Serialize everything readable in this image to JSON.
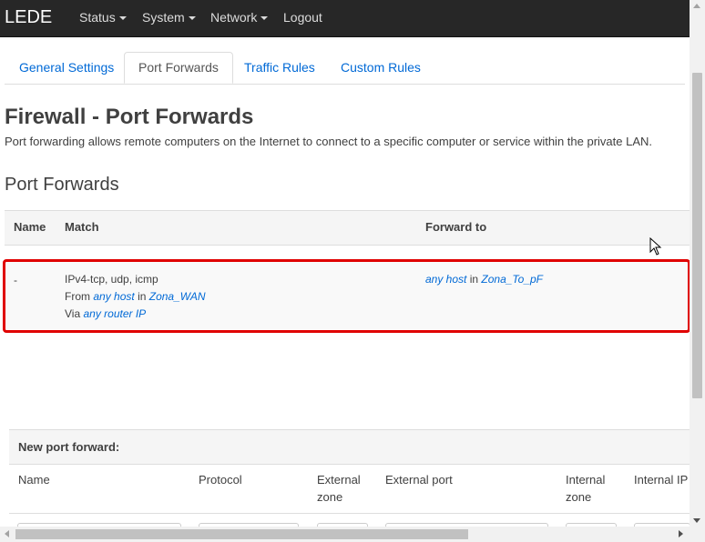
{
  "navbar": {
    "brand": "LEDE",
    "items": [
      {
        "label": "Status",
        "dropdown": true
      },
      {
        "label": "System",
        "dropdown": true
      },
      {
        "label": "Network",
        "dropdown": true
      },
      {
        "label": "Logout",
        "dropdown": false
      }
    ]
  },
  "tabs": [
    {
      "label": "General Settings",
      "active": false
    },
    {
      "label": "Port Forwards",
      "active": true
    },
    {
      "label": "Traffic Rules",
      "active": false
    },
    {
      "label": "Custom Rules",
      "active": false
    }
  ],
  "page": {
    "title": "Firewall - Port Forwards",
    "description": "Port forwarding allows remote computers on the Internet to connect to a specific computer or service within the private LAN.",
    "section_title": "Port Forwards"
  },
  "table": {
    "headers": {
      "name": "Name",
      "match": "Match",
      "forward_to": "Forward to"
    },
    "rows": [
      {
        "name": "-",
        "match_protocol": "IPv4-tcp, udp, icmp",
        "from_prefix": "From",
        "from_host": "any host",
        "in_word": "in",
        "from_zone": "Zona_WAN",
        "via_prefix": "Via",
        "via_target": "any router IP",
        "forward_host": "any host",
        "forward_in": "in",
        "forward_zone": "Zona_To_pF"
      }
    ]
  },
  "new_port_forward": {
    "title": "New port forward:",
    "columns": {
      "name": "Name",
      "protocol": "Protocol",
      "external_zone": "External zone",
      "external_port": "External port",
      "internal_zone": "Internal zone",
      "internal_ip": "Internal IP"
    }
  },
  "colors": {
    "navbar_bg": "#272727",
    "link": "#0069d6",
    "highlight_border": "#e00000"
  }
}
